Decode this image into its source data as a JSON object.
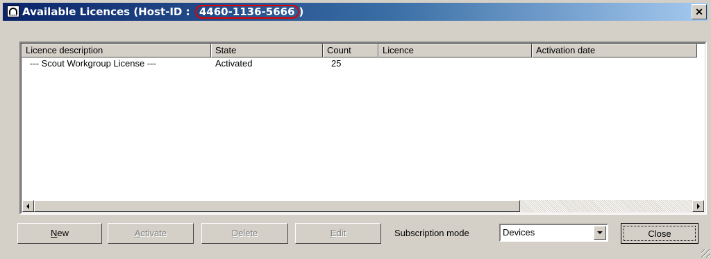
{
  "window": {
    "title_prefix": "Available Licences (Host-ID : ",
    "host_id": "4460-1136-5666",
    "title_suffix": ")",
    "close_glyph": "✕"
  },
  "table": {
    "columns": [
      "Licence description",
      "State",
      "Count",
      "Licence",
      "Activation date"
    ],
    "rows": [
      {
        "description": "--- Scout Workgroup License ---",
        "state": "Activated",
        "count": "25",
        "licence": "",
        "activation_date": ""
      }
    ]
  },
  "buttons": {
    "new": {
      "mnemonic": "N",
      "rest": "ew"
    },
    "activate": {
      "mnemonic": "A",
      "rest": "ctivate"
    },
    "delete": {
      "mnemonic": "D",
      "rest": "elete"
    },
    "edit": {
      "mnemonic": "E",
      "rest": "dit"
    },
    "close": "Close"
  },
  "subscription": {
    "label": "Subscription mode",
    "value": "Devices"
  },
  "icons": {
    "app": "scout-app-icon",
    "close": "close-icon",
    "scroll_left": "scroll-left-arrow-icon",
    "scroll_right": "scroll-right-arrow-icon",
    "dropdown": "chevron-down-icon",
    "resize": "resize-grip-icon"
  },
  "colors": {
    "title_start": "#0a246a",
    "title_end": "#a6caf0",
    "highlight": "#e00000",
    "face": "#d4d0c8"
  }
}
